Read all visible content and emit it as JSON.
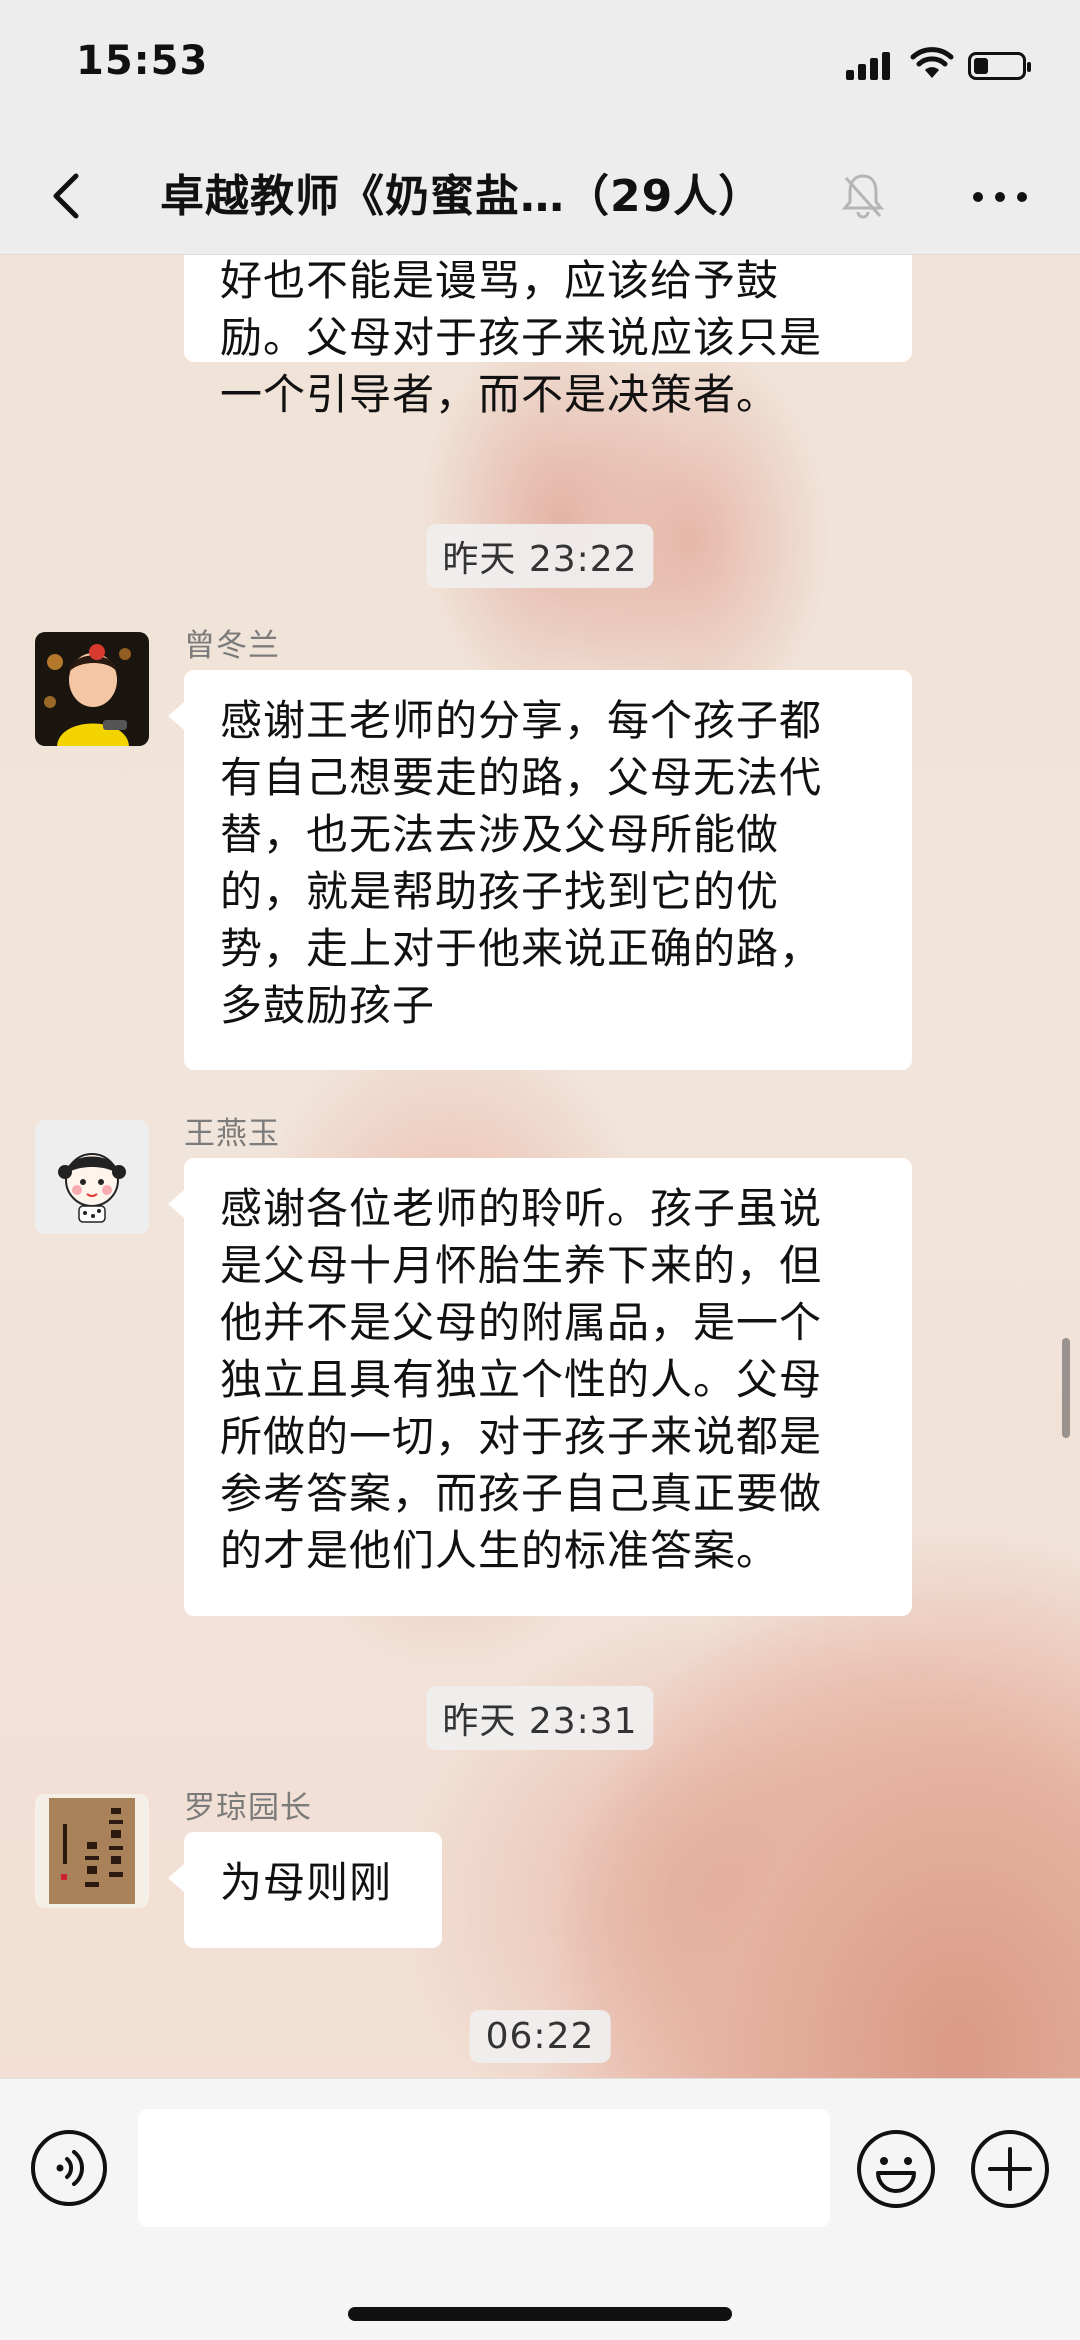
{
  "status_bar": {
    "time": "15:53"
  },
  "header": {
    "title": "卓越教师《奶蜜盐…（29人）"
  },
  "messages": [
    {
      "type": "message",
      "text": "好也不能是谩骂，应该给予鼓\n励。父母对于孩子来说应该只是\n一个引导者，而不是决策者。"
    },
    {
      "type": "timestamp",
      "text": "昨天 23:22"
    },
    {
      "type": "message",
      "sender": "曾冬兰",
      "text": "感谢王老师的分享，每个孩子都\n有自己想要走的路，父母无法代\n替，也无法去涉及父母所能做\n的，就是帮助孩子找到它的优\n势，走上对于他来说正确的路，\n多鼓励孩子"
    },
    {
      "type": "message",
      "sender": "王燕玉",
      "text": "感谢各位老师的聆听。孩子虽说\n是父母十月怀胎生养下来的，但\n他并不是父母的附属品，是一个\n独立且具有独立个性的人。父母\n所做的一切，对于孩子来说都是\n参考答案，而孩子自己真正要做\n的才是他们人生的标准答案。"
    },
    {
      "type": "timestamp",
      "text": "昨天 23:31"
    },
    {
      "type": "message",
      "sender": "罗琼园长",
      "text": "为母则刚"
    },
    {
      "type": "timestamp",
      "text": "06:22"
    }
  ],
  "avatars": {
    "avatar_1_desc_icon": "toddler-photo-icon",
    "avatar_2_desc_icon": "cartoon-girl-icon",
    "avatar_3_desc_icon": "calligraphy-icon"
  },
  "input_bar": {
    "placeholder": ""
  },
  "colors": {
    "bubble": "#ffffff",
    "bar": "#ededed",
    "wallpaper": "#efe5dc"
  }
}
